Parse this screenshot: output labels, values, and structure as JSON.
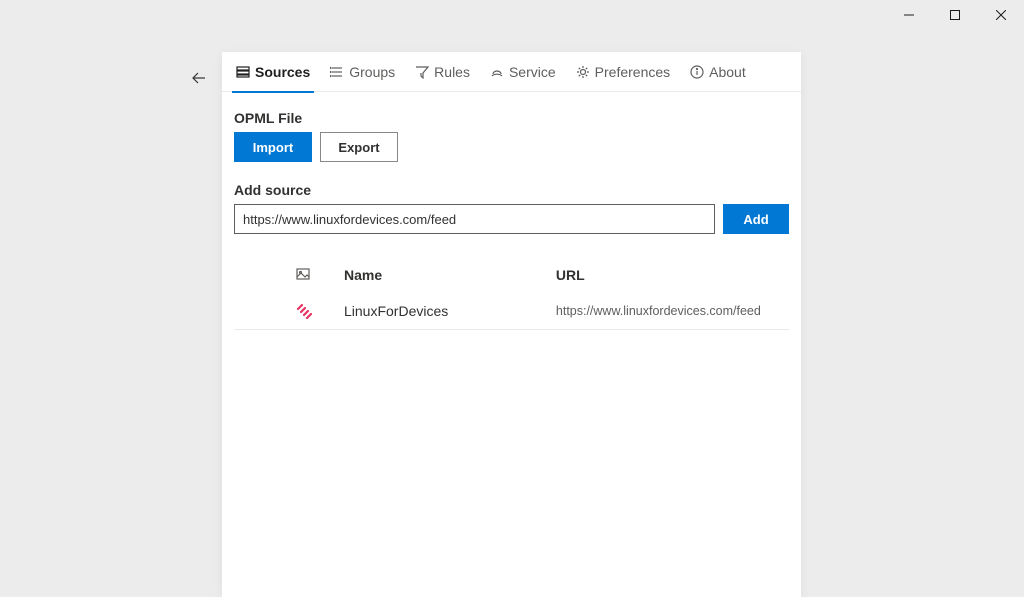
{
  "tabs": {
    "sources": "Sources",
    "groups": "Groups",
    "rules": "Rules",
    "service": "Service",
    "preferences": "Preferences",
    "about": "About"
  },
  "opml": {
    "heading": "OPML File",
    "import_label": "Import",
    "export_label": "Export"
  },
  "add_source": {
    "heading": "Add source",
    "input_value": "https://www.linuxfordevices.com/feed",
    "add_label": "Add"
  },
  "table": {
    "headers": {
      "name": "Name",
      "url": "URL"
    },
    "rows": [
      {
        "name": "LinuxForDevices",
        "url": "https://www.linuxfordevices.com/feed"
      }
    ]
  },
  "colors": {
    "accent": "#0078d4",
    "source_icon": "#e63363"
  }
}
